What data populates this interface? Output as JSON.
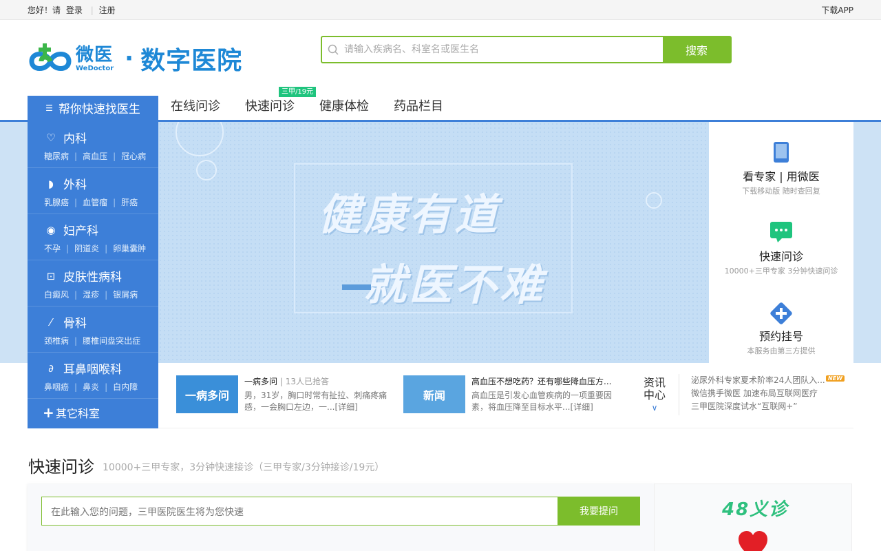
{
  "topbar": {
    "greeting": "您好！请",
    "login": "登录",
    "register": "注册",
    "download": "下载APP"
  },
  "logo": {
    "cn": "微医",
    "en": "WeDoctor",
    "title": "数字医院"
  },
  "search": {
    "placeholder": "请输入疾病名、科室名或医生名",
    "button": "搜索"
  },
  "nav": {
    "category": "帮你快速找医生",
    "items": [
      "在线问诊",
      "快速问诊",
      "健康体检",
      "药品栏目"
    ],
    "badge": "三甲/19元"
  },
  "sidemenu": [
    {
      "title": "内科",
      "icon": "heart-icon",
      "subs": [
        "糖尿病",
        "高血压",
        "冠心病"
      ]
    },
    {
      "title": "外科",
      "icon": "stomach-icon",
      "subs": [
        "乳腺癌",
        "血管瘤",
        "肝癌"
      ]
    },
    {
      "title": "妇产科",
      "icon": "baby-icon",
      "subs": [
        "不孕",
        "阴道炎",
        "卵巢囊肿"
      ]
    },
    {
      "title": "皮肤性病科",
      "icon": "skin-icon",
      "subs": [
        "白癜风",
        "湿疹",
        "银屑病"
      ]
    },
    {
      "title": "骨科",
      "icon": "bone-icon",
      "subs": [
        "颈椎病",
        "腰椎间盘突出症"
      ]
    },
    {
      "title": "耳鼻咽喉科",
      "icon": "ear-icon",
      "subs": [
        "鼻咽癌",
        "鼻炎",
        "白内障"
      ]
    }
  ],
  "other_dept": "其它科室",
  "banner": {
    "line1": "健康有道",
    "line2": "就医不难"
  },
  "rightpanel": [
    {
      "title": "看专家 | 用微医",
      "sub": "下载移动版 随时查回复",
      "icon": "phone-icon"
    },
    {
      "title": "快速问诊",
      "sub": "10000+三甲专家 3分钟快速问诊",
      "icon": "chat-icon"
    },
    {
      "title": "预约挂号",
      "sub": "本服务由第三方提供",
      "icon": "plus-icon"
    }
  ],
  "news": [
    {
      "thumb": "一病多问",
      "title": "一病多问",
      "meta": "| 13人已抢答",
      "desc": "男，31岁，胸口时常有扯拉、刺痛疼痛感，一会胸口左边，一...[详细]",
      "color": "#3a8fd9"
    },
    {
      "thumb": "新闻",
      "title": "高血压不想吃药？还有哪些降血压方...",
      "meta": "",
      "desc": "高血压是引发心血管疾病的一项重要因素，将血压降至目标水平...[详细]",
      "color": "#5aa5e0"
    }
  ],
  "info": {
    "label1": "资讯",
    "label2": "中心",
    "items": [
      "泌尿外科专家夏术阶率24人团队入...",
      "微信携手微医 加速布局互联网医疗",
      "三甲医院深度试水“互联网+”"
    ],
    "new_tag": "NEW"
  },
  "quick": {
    "title": "快速问诊",
    "subtitle": "10000+三甲专家，3分钟快速接诊（三甲专家/3分钟接诊/19元）",
    "input_placeholder": "在此输入您的问题，三甲医院医生将为您快速",
    "ask_button": "我要提问",
    "ad_logo": "48义诊"
  },
  "colors": {
    "brand_blue": "#3d7fd8",
    "green": "#7cbd2c",
    "logo_blue": "#1e88d6"
  }
}
